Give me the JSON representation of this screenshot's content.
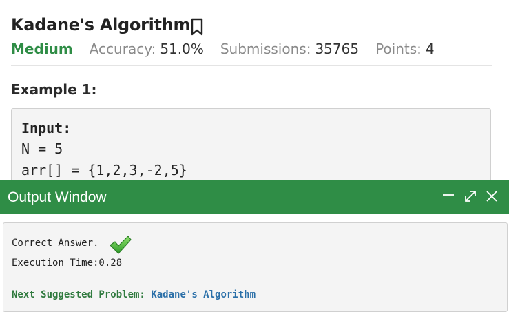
{
  "problem": {
    "title": "Kadane's Algorithm",
    "difficulty": "Medium",
    "accuracy_label": "Accuracy:",
    "accuracy_value": "51.0%",
    "submissions_label": "Submissions:",
    "submissions_value": "35765",
    "points_label": "Points:",
    "points_value": "4",
    "bookmark_icon": "bookmark-icon"
  },
  "example": {
    "heading": "Example 1:",
    "input_label": "Input:",
    "line_n": "N = 5",
    "line_arr": "arr[] = {1,2,3,-2,5}"
  },
  "output_window": {
    "title": "Output Window",
    "controls": [
      "minimize-icon",
      "expand-icon",
      "close-icon"
    ],
    "result": "Correct Answer.",
    "result_icon": "checkmark-icon",
    "execution_time": "Execution Time:0.28",
    "next_label": "Next Suggested Problem:",
    "next_problem": "Kadane's Algorithm"
  },
  "colors": {
    "brand_green": "#2f8d46",
    "link_blue": "#2a6fa8",
    "check_green": "#4cc23a"
  }
}
